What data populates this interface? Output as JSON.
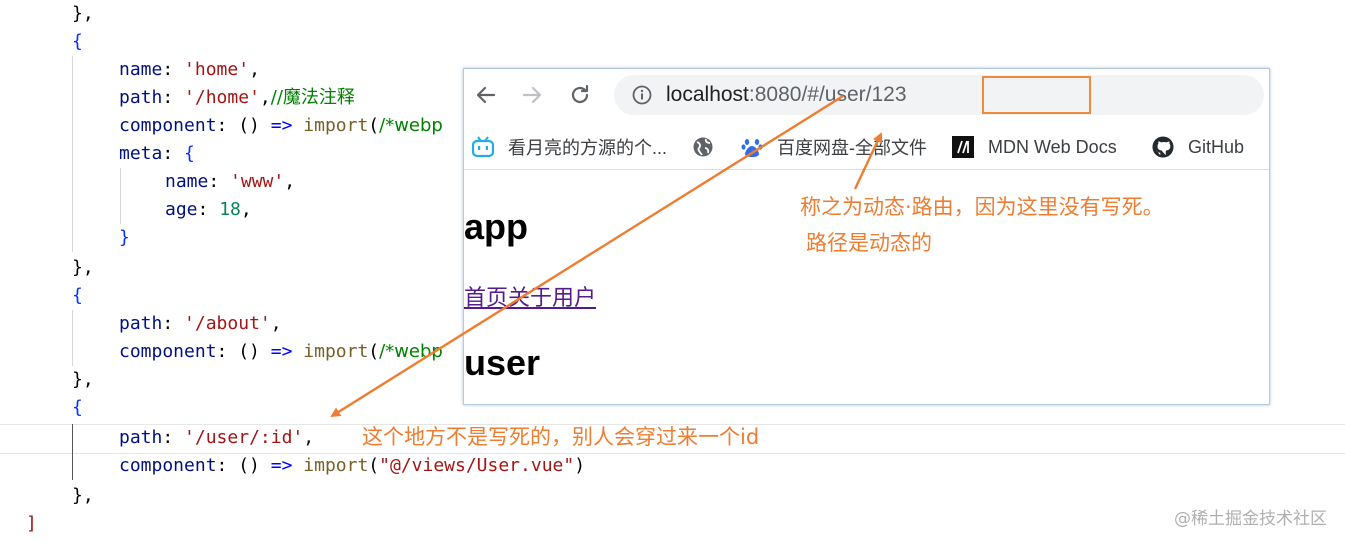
{
  "editor": {
    "lines": [
      {
        "parts": [
          [
            "p",
            "},"
          ]
        ]
      },
      {
        "parts": [
          [
            "br",
            "{"
          ]
        ]
      },
      {
        "parts": [
          [
            "k",
            "name"
          ],
          [
            "p",
            ": "
          ],
          [
            "s",
            "'home'"
          ],
          [
            "p",
            ","
          ]
        ]
      },
      {
        "parts": [
          [
            "k",
            "path"
          ],
          [
            "p",
            ": "
          ],
          [
            "s",
            "'/home'"
          ],
          [
            "p",
            ","
          ],
          [
            "c",
            "//魔法注释"
          ]
        ]
      },
      {
        "parts": [
          [
            "k",
            "component"
          ],
          [
            "p",
            ": () "
          ],
          [
            "kw",
            "=>"
          ],
          [
            "p",
            " "
          ],
          [
            "f",
            "import"
          ],
          [
            "p",
            "("
          ],
          [
            "c",
            "/*webp"
          ]
        ]
      },
      {
        "parts": [
          [
            "k",
            "meta"
          ],
          [
            "p",
            ": "
          ],
          [
            "br",
            "{"
          ]
        ]
      },
      {
        "parts": [
          [
            "k",
            "name"
          ],
          [
            "p",
            ": "
          ],
          [
            "s",
            "'www'"
          ],
          [
            "p",
            ","
          ]
        ]
      },
      {
        "parts": [
          [
            "k",
            "age"
          ],
          [
            "p",
            ": "
          ],
          [
            "n",
            "18"
          ],
          [
            "p",
            ","
          ]
        ]
      },
      {
        "parts": [
          [
            "br",
            "}"
          ]
        ]
      },
      {
        "parts": [
          [
            "p",
            "},"
          ]
        ]
      },
      {
        "parts": [
          [
            "br",
            "{"
          ]
        ]
      },
      {
        "parts": [
          [
            "p",
            ""
          ]
        ]
      },
      {
        "parts": [
          [
            "k",
            "path"
          ],
          [
            "p",
            ": "
          ],
          [
            "s",
            "'/about'"
          ],
          [
            "p",
            ","
          ]
        ]
      },
      {
        "parts": [
          [
            "k",
            "component"
          ],
          [
            "p",
            ": () "
          ],
          [
            "kw",
            "=>"
          ],
          [
            "p",
            " "
          ],
          [
            "f",
            "import"
          ],
          [
            "p",
            "("
          ],
          [
            "c",
            "/*webp"
          ]
        ]
      },
      {
        "parts": [
          [
            "p",
            "},"
          ]
        ]
      },
      {
        "parts": [
          [
            "br",
            "{"
          ]
        ]
      },
      {
        "parts": [
          [
            "k",
            "path"
          ],
          [
            "p",
            ": "
          ],
          [
            "s",
            "'/user/:id'"
          ],
          [
            "p",
            ","
          ]
        ]
      },
      {
        "parts": [
          [
            "k",
            "component"
          ],
          [
            "p",
            ": () "
          ],
          [
            "kw",
            "=>"
          ],
          [
            "p",
            " "
          ],
          [
            "f",
            "import"
          ],
          [
            "p",
            "("
          ],
          [
            "s",
            "\"@/views/User.vue\""
          ],
          [
            "p",
            ")"
          ]
        ]
      },
      {
        "parts": [
          [
            "p",
            "},"
          ]
        ]
      },
      {
        "parts": [
          [
            "s",
            "]"
          ]
        ]
      }
    ]
  },
  "browser": {
    "url_host": "localhost",
    "url_rest": ":8080/#/user/123",
    "bookmarks": [
      {
        "icon": "bilibili-icon",
        "label": "看月亮的方源的个..."
      },
      {
        "icon": "globe-icon",
        "label": ""
      },
      {
        "icon": "baidu-icon",
        "label": "百度网盘-全部文件"
      },
      {
        "icon": "mdn-icon",
        "label": "MDN Web Docs"
      },
      {
        "icon": "github-icon",
        "label": "GitHub"
      }
    ],
    "page": {
      "heading": "app",
      "links": "首页关于用户",
      "subheading": "user"
    }
  },
  "annotations": {
    "top_line1": "称之为动态·路由，因为这里没有写死。",
    "top_line2": "路径是动态的",
    "bottom": "这个地方不是写死的，别人会穿过来一个id",
    "color": "#ee7d31"
  },
  "watermark": "@稀土掘金技术社区"
}
